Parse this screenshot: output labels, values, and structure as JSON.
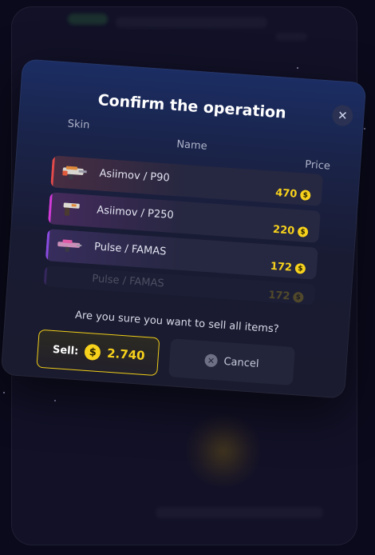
{
  "modal": {
    "title": "Confirm the operation",
    "close_icon": "close-icon",
    "columns": {
      "skin": "Skin",
      "name": "Name",
      "price": "Price"
    },
    "items": [
      {
        "name": "Asiimov / P90",
        "price": "470",
        "rarity_color": "#e34a4a",
        "icon": "p90-gun-icon"
      },
      {
        "name": "Asiimov / P250",
        "price": "220",
        "rarity_color": "#d23ad8",
        "icon": "p250-gun-icon"
      },
      {
        "name": "Pulse / FAMAS",
        "price": "172",
        "rarity_color": "#8a4be0",
        "icon": "famas-gun-icon"
      },
      {
        "name": "Pulse / FAMAS",
        "price": "172",
        "rarity_color": "#8a4be0",
        "icon": "famas-gun-icon"
      }
    ],
    "question": "Are you sure you want to sell all items?",
    "sell": {
      "label": "Sell:",
      "amount": "2.740",
      "coin_symbol": "$"
    },
    "cancel": {
      "label": "Cancel"
    }
  },
  "colors": {
    "accent": "#f7d21c",
    "background": "#0b0a1c"
  }
}
